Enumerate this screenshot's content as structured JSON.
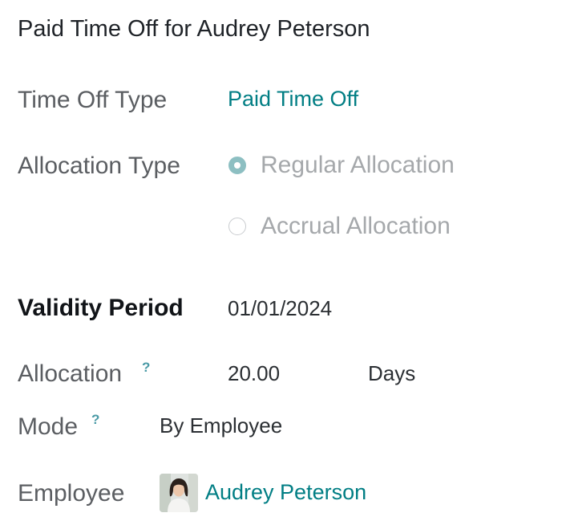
{
  "form": {
    "title": "Paid Time Off for Audrey Peterson",
    "time_off_type": {
      "label": "Time Off Type",
      "value": "Paid Time Off"
    },
    "allocation_type": {
      "label": "Allocation Type",
      "options": [
        {
          "label": "Regular Allocation",
          "checked": true
        },
        {
          "label": "Accrual Allocation",
          "checked": false
        }
      ]
    },
    "validity_period": {
      "label": "Validity Period",
      "value": "01/01/2024"
    },
    "allocation": {
      "label": "Allocation",
      "help": "?",
      "value": "20.00",
      "unit": "Days"
    },
    "mode": {
      "label": "Mode",
      "help": "?",
      "value": "By Employee"
    },
    "employee": {
      "label": "Employee",
      "value": "Audrey Peterson",
      "avatar_icon": "employee-photo"
    }
  },
  "colors": {
    "accent": "#017e84",
    "radio_checked": "#8dbfc2",
    "label": "#5b5e62"
  }
}
